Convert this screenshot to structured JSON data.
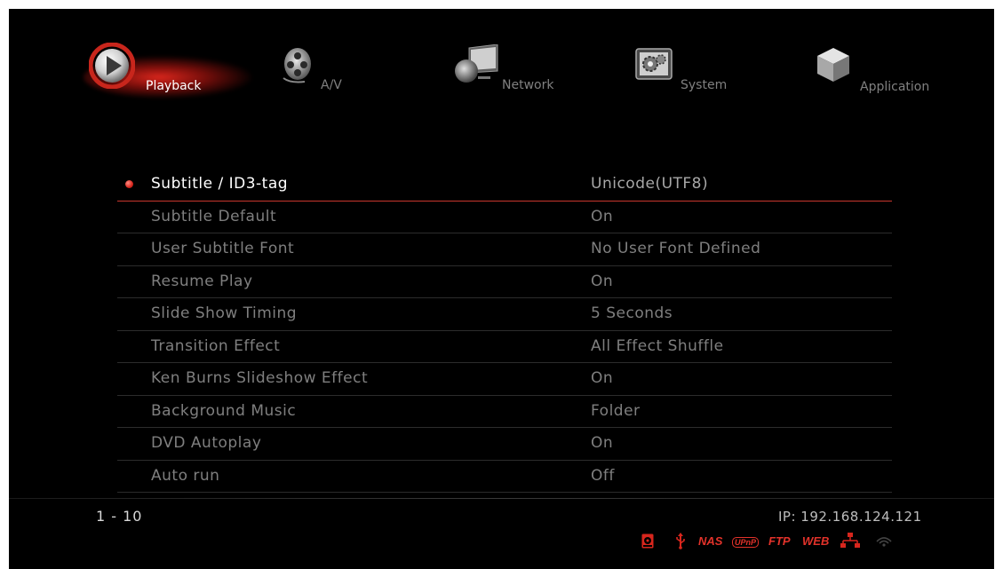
{
  "nav": {
    "tabs": [
      {
        "label": "Playback",
        "icon": "play-icon",
        "active": true
      },
      {
        "label": "A/V",
        "icon": "film-reel-icon",
        "active": false
      },
      {
        "label": "Network",
        "icon": "network-monitor-icon",
        "active": false
      },
      {
        "label": "System",
        "icon": "system-gear-icon",
        "active": false
      },
      {
        "label": "Application",
        "icon": "application-cube-icon",
        "active": false
      }
    ]
  },
  "settings": {
    "items": [
      {
        "label": "Subtitle / ID3-tag",
        "value": "Unicode(UTF8)"
      },
      {
        "label": "Subtitle Default",
        "value": "On"
      },
      {
        "label": "User Subtitle Font",
        "value": "No User Font Defined"
      },
      {
        "label": "Resume Play",
        "value": "On"
      },
      {
        "label": "Slide Show Timing",
        "value": "5 Seconds"
      },
      {
        "label": "Transition Effect",
        "value": "All Effect Shuffle"
      },
      {
        "label": "Ken Burns Slideshow Effect",
        "value": "On"
      },
      {
        "label": "Background Music",
        "value": "Folder"
      },
      {
        "label": "DVD Autoplay",
        "value": "On"
      },
      {
        "label": "Auto run",
        "value": "Off"
      }
    ],
    "selected_index": 0
  },
  "footer": {
    "page_range": "1 - 10",
    "ip": "IP: 192.168.124.121",
    "status_icons": {
      "hdd": "hdd-icon",
      "usb": "usb-icon",
      "nas": "NAS",
      "upnp": "UPnP",
      "ftp": "FTP",
      "web": "WEB",
      "lan": "lan-icon",
      "wifi": "wifi-icon"
    }
  },
  "colors": {
    "accent": "#d7261d",
    "text_selected": "#ffffff",
    "text_normal": "#7f7f7f",
    "background": "#000000"
  }
}
